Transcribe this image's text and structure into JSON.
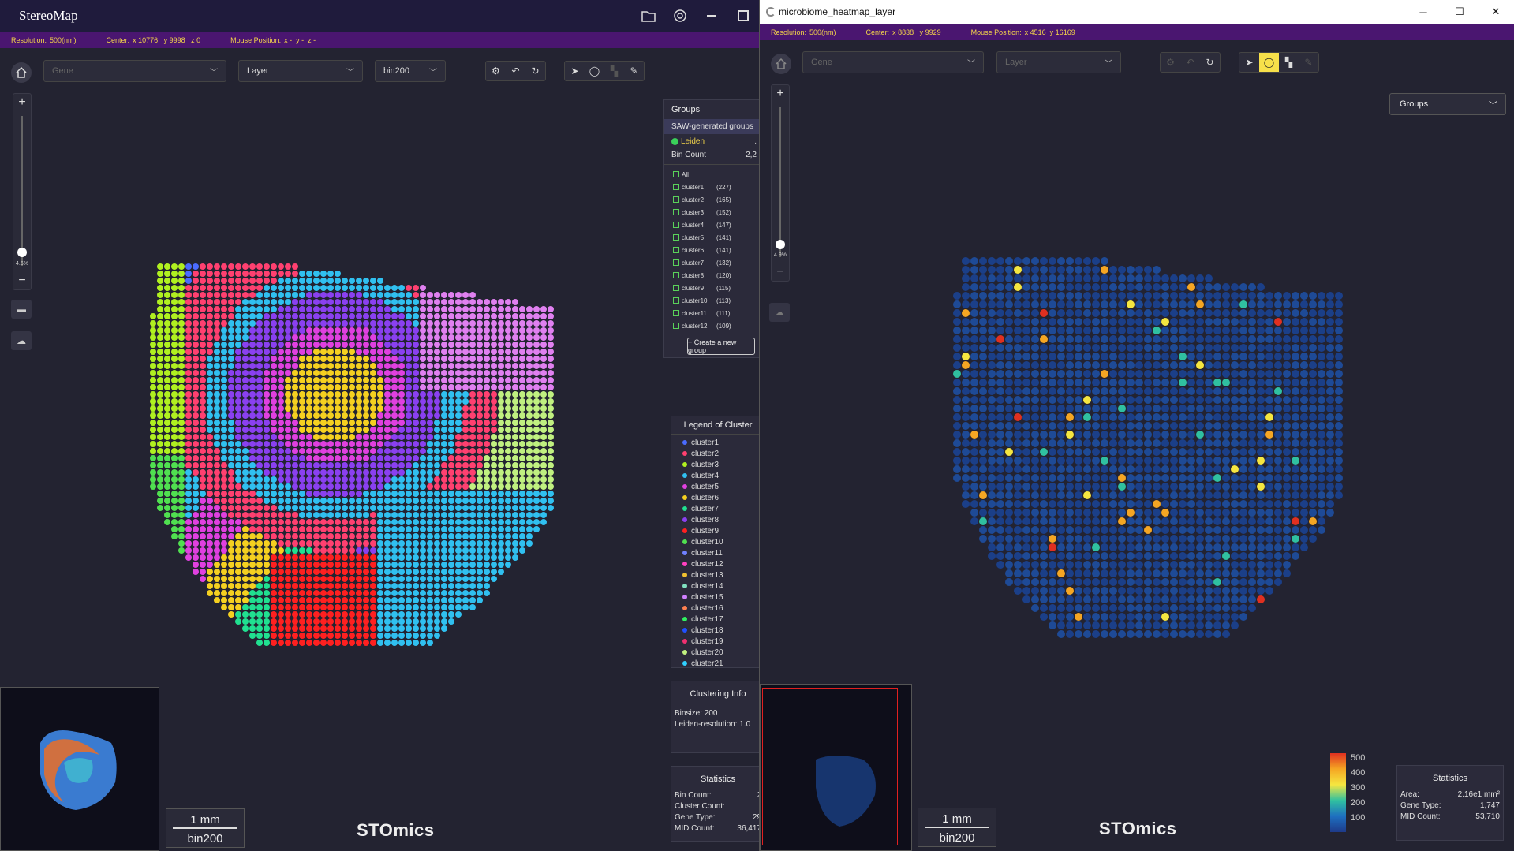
{
  "left_window": {
    "title": "StereoMap",
    "info": {
      "resolution_label": "Resolution:",
      "resolution": "500(nm)",
      "center_label": "Center:",
      "center": "x 10776   y 9998   z 0",
      "mouse_label": "Mouse Position:",
      "mouse": "x -  y -  z -"
    },
    "toolbar": {
      "gene_placeholder": "Gene",
      "layer": "Layer",
      "bin": "bin200"
    },
    "zoom_value": "4.6%",
    "groups": {
      "title": "Groups",
      "saw_header": "SAW-generated groups",
      "leiden": "Leiden",
      "leiden_extra": ".",
      "bin_count_label": "Bin Count",
      "bin_count_value": "2,2",
      "all_label": "All",
      "rows": [
        {
          "name": "cluster1",
          "count": "(227)"
        },
        {
          "name": "cluster2",
          "count": "(165)"
        },
        {
          "name": "cluster3",
          "count": "(152)"
        },
        {
          "name": "cluster4",
          "count": "(147)"
        },
        {
          "name": "cluster5",
          "count": "(141)"
        },
        {
          "name": "cluster6",
          "count": "(141)"
        },
        {
          "name": "cluster7",
          "count": "(132)"
        },
        {
          "name": "cluster8",
          "count": "(120)"
        },
        {
          "name": "cluster9",
          "count": "(115)"
        },
        {
          "name": "cluster10",
          "count": "(113)"
        },
        {
          "name": "cluster11",
          "count": "(111)"
        },
        {
          "name": "cluster12",
          "count": "(109)"
        }
      ],
      "create_button": "+ Create a new group"
    },
    "legend": {
      "title": "Legend of Cluster",
      "items": [
        {
          "name": "cluster1",
          "color": "#4a6bff"
        },
        {
          "name": "cluster2",
          "color": "#ff4070"
        },
        {
          "name": "cluster3",
          "color": "#b0f020"
        },
        {
          "name": "cluster4",
          "color": "#30c0f0"
        },
        {
          "name": "cluster5",
          "color": "#e040e0"
        },
        {
          "name": "cluster6",
          "color": "#f5d020"
        },
        {
          "name": "cluster7",
          "color": "#20e090"
        },
        {
          "name": "cluster8",
          "color": "#8a40f0"
        },
        {
          "name": "cluster9",
          "color": "#ff2020"
        },
        {
          "name": "cluster10",
          "color": "#50e050"
        },
        {
          "name": "cluster11",
          "color": "#7080ff"
        },
        {
          "name": "cluster12",
          "color": "#ff40c0"
        },
        {
          "name": "cluster13",
          "color": "#f0c030"
        },
        {
          "name": "cluster14",
          "color": "#80e0c0"
        },
        {
          "name": "cluster15",
          "color": "#d080ff"
        },
        {
          "name": "cluster16",
          "color": "#ff8050"
        },
        {
          "name": "cluster17",
          "color": "#30f060"
        },
        {
          "name": "cluster18",
          "color": "#2050ff"
        },
        {
          "name": "cluster19",
          "color": "#f03070"
        },
        {
          "name": "cluster20",
          "color": "#c0f080"
        },
        {
          "name": "cluster21",
          "color": "#30d0ff"
        }
      ]
    },
    "clustering_info": {
      "title": "Clustering Info",
      "binsize": "Binsize: 200",
      "resolution": "Leiden-resolution: 1.0"
    },
    "statistics": {
      "title": "Statistics",
      "rows": [
        {
          "label": "Bin Count:",
          "value": "2"
        },
        {
          "label": "Cluster Count:",
          "value": ""
        },
        {
          "label": "Gene Type:",
          "value": "29"
        },
        {
          "label": "MID Count:",
          "value": "36,417"
        }
      ]
    },
    "scalebar": {
      "distance": "1 mm",
      "bin": "bin200"
    },
    "brand": "STOmics"
  },
  "right_window": {
    "title": "microbiome_heatmap_layer",
    "info": {
      "resolution_label": "Resolution:",
      "resolution": "500(nm)",
      "center_label": "Center:",
      "center": "x 8838   y 9929",
      "mouse_label": "Mouse Position:",
      "mouse": "x 4516  y 16169"
    },
    "toolbar": {
      "gene_placeholder": "Gene",
      "layer": "Layer"
    },
    "zoom_value": "4.9%",
    "groups_select": "Groups",
    "colorbar": {
      "ticks": [
        "500",
        "400",
        "300",
        "200",
        "100"
      ],
      "colors": [
        "#e03020",
        "#f5a623",
        "#f5e640",
        "#30c0a0",
        "#1e6fc0",
        "#1e3b8a"
      ]
    },
    "statistics": {
      "title": "Statistics",
      "rows": [
        {
          "label": "Area:",
          "value": "2.16e1 mm²"
        },
        {
          "label": "Gene Type:",
          "value": "1,747"
        },
        {
          "label": "MID Count:",
          "value": "53,710"
        }
      ]
    },
    "scalebar": {
      "distance": "1 mm",
      "bin": "bin200"
    },
    "brand": "STOmics"
  },
  "icons": [
    "home-icon",
    "folder-icon",
    "camera-icon",
    "minimize-icon",
    "maximize-icon",
    "settings-icon",
    "undo-icon",
    "refresh-icon",
    "pointer-icon",
    "lasso-icon",
    "rect-select-icon",
    "eraser-icon",
    "cloud-icon",
    "close-icon"
  ]
}
